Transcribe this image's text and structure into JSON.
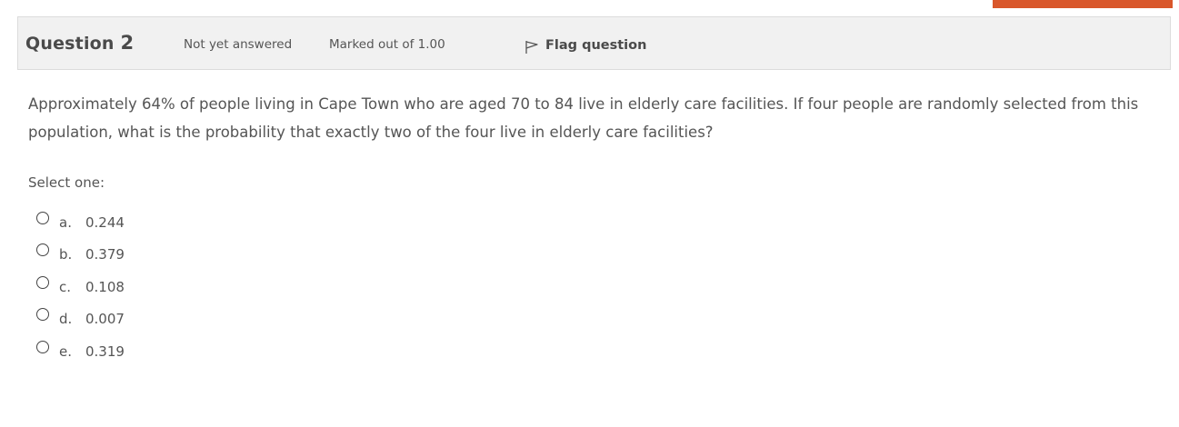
{
  "header": {
    "question_word": "Question",
    "question_number": "2",
    "state": "Not yet answered",
    "grade": "Marked out of 1.00",
    "flag_label": "Flag question",
    "flag_icon": "flag-icon"
  },
  "question": {
    "text": "Approximately 64% of people living in Cape Town who are aged 70 to 84 live in elderly care facilities. If four people are randomly selected from this population, what is the probability that exactly two of the four live in elderly care facilities?",
    "prompt": "Select one:",
    "options": [
      {
        "letter": "a.",
        "value": "0.244"
      },
      {
        "letter": "b.",
        "value": "0.379"
      },
      {
        "letter": "c.",
        "value": "0.108"
      },
      {
        "letter": "d.",
        "value": "0.007"
      },
      {
        "letter": "e.",
        "value": "0.319"
      }
    ]
  },
  "colors": {
    "accent": "#d9572b",
    "header_bg": "#f1f1f1",
    "text": "#555555"
  }
}
